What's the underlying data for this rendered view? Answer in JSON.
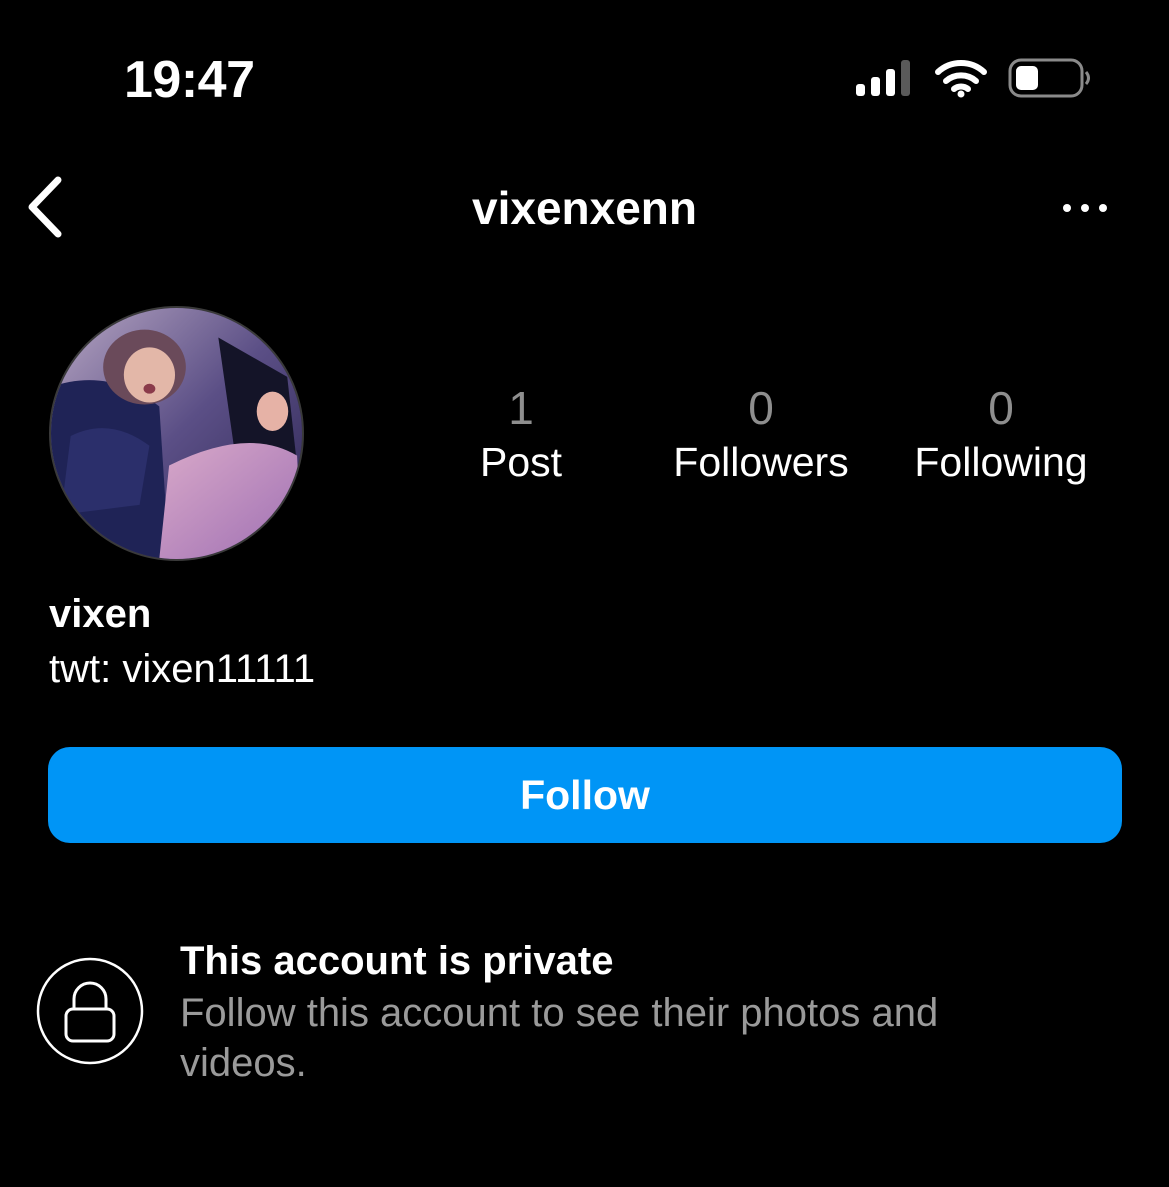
{
  "status_bar": {
    "time": "19:47",
    "icons": [
      "cellular-signal-icon",
      "wifi-icon",
      "battery-icon"
    ]
  },
  "header": {
    "username": "vixenxenn",
    "back_icon": "chevron-left-icon",
    "more_icon": "more-horizontal-icon"
  },
  "profile": {
    "stats": [
      {
        "count": "1",
        "label": "Post"
      },
      {
        "count": "0",
        "label": "Followers"
      },
      {
        "count": "0",
        "label": "Following"
      }
    ],
    "display_name": "vixen",
    "bio": "twt: vixen11111"
  },
  "actions": {
    "follow_label": "Follow"
  },
  "private_notice": {
    "icon": "lock-icon",
    "title": "This account is private",
    "description": "Follow this account to see their photos and videos."
  },
  "colors": {
    "background": "#000000",
    "accent": "#0095f6",
    "secondary_text": "#8e8e8e"
  }
}
